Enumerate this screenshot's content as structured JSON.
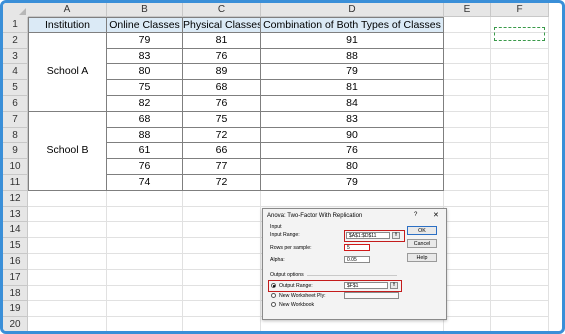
{
  "columns": [
    "A",
    "B",
    "C",
    "D",
    "E",
    "F"
  ],
  "rows": [
    "1",
    "2",
    "3",
    "4",
    "5",
    "6",
    "7",
    "8",
    "9",
    "10",
    "11",
    "12",
    "13",
    "14",
    "15",
    "16",
    "17",
    "18",
    "19",
    "20"
  ],
  "table": {
    "headers": [
      "Institution",
      "Online Classes",
      "Physical Classes",
      "Combination of Both Types of Classes"
    ],
    "groups": [
      {
        "name": "School A",
        "rows": [
          [
            "79",
            "81",
            "91"
          ],
          [
            "83",
            "76",
            "88"
          ],
          [
            "80",
            "89",
            "79"
          ],
          [
            "75",
            "68",
            "81"
          ],
          [
            "82",
            "76",
            "84"
          ]
        ]
      },
      {
        "name": "School B",
        "rows": [
          [
            "68",
            "75",
            "83"
          ],
          [
            "88",
            "72",
            "90"
          ],
          [
            "61",
            "66",
            "76"
          ],
          [
            "76",
            "77",
            "80"
          ],
          [
            "74",
            "72",
            "79"
          ]
        ]
      }
    ]
  },
  "dialog": {
    "title": "Anova: Two-Factor With Replication",
    "help_glyph": "?",
    "close_glyph": "✕",
    "input_section": "Input",
    "input_range_label": "Input Range:",
    "input_range_value": "$A$1:$D$11",
    "rows_per_sample_label": "Rows per sample:",
    "rows_per_sample_value": "5",
    "alpha_label": "Alpha:",
    "alpha_value": "0.05",
    "output_section": "Output options",
    "output_range_label": "Output Range:",
    "output_range_value": "$F$1",
    "new_ws_label": "New Worksheet Ply:",
    "new_wb_label": "New Workbook",
    "ok_label": "OK",
    "cancel_label": "Cancel",
    "help_label": "Help"
  }
}
